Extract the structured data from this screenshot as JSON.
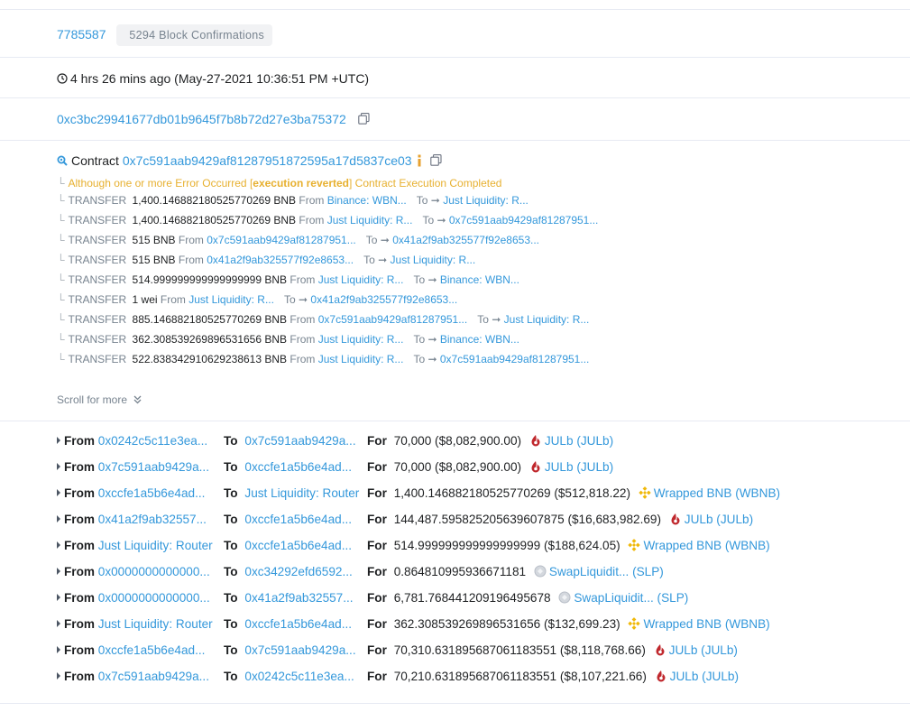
{
  "block": {
    "number": "7785587",
    "confirmations": "5294 Block Confirmations"
  },
  "timestamp": "4 hrs 26 mins ago (May-27-2021 10:36:51 PM +UTC)",
  "from_address": "0xc3bc29941677db01b9645f7b8b72d27e3ba75372",
  "interacted_with": {
    "prefix": "Contract",
    "address": "0x7c591aab9429af81287951872595a17d5837ce03"
  },
  "internal_error": {
    "part1": "Although one or more Error Occurred [",
    "bold": "execution reverted",
    "part2": "] Contract Execution Completed"
  },
  "internal_transfers": [
    {
      "label": "TRANSFER",
      "amount": "1,400.146882180525770269 BNB",
      "from_label": "From",
      "from": "Binance: WBN...",
      "to_label": "To",
      "to": "Just Liquidity: R..."
    },
    {
      "label": "TRANSFER",
      "amount": "1,400.146882180525770269 BNB",
      "from_label": "From",
      "from": "Just Liquidity: R...",
      "to_label": "To",
      "to": "0x7c591aab9429af81287951..."
    },
    {
      "label": "TRANSFER",
      "amount": "515 BNB",
      "from_label": "From",
      "from": "0x7c591aab9429af81287951...",
      "to_label": "To",
      "to": "0x41a2f9ab325577f92e8653..."
    },
    {
      "label": "TRANSFER",
      "amount": "515 BNB",
      "from_label": "From",
      "from": "0x41a2f9ab325577f92e8653...",
      "to_label": "To",
      "to": "Just Liquidity: R..."
    },
    {
      "label": "TRANSFER",
      "amount": "514.999999999999999999 BNB",
      "from_label": "From",
      "from": "Just Liquidity: R...",
      "to_label": "To",
      "to": "Binance: WBN..."
    },
    {
      "label": "TRANSFER",
      "amount": "1 wei",
      "from_label": "From",
      "from": "Just Liquidity: R...",
      "to_label": "To",
      "to": "0x41a2f9ab325577f92e8653..."
    },
    {
      "label": "TRANSFER",
      "amount": "885.146882180525770269 BNB",
      "from_label": "From",
      "from": "0x7c591aab9429af81287951...",
      "to_label": "To",
      "to": "Just Liquidity: R..."
    },
    {
      "label": "TRANSFER",
      "amount": "362.308539269896531656 BNB",
      "from_label": "From",
      "from": "Just Liquidity: R...",
      "to_label": "To",
      "to": "Binance: WBN..."
    },
    {
      "label": "TRANSFER",
      "amount": "522.838342910629238613 BNB",
      "from_label": "From",
      "from": "Just Liquidity: R...",
      "to_label": "To",
      "to": "0x7c591aab9429af81287951..."
    }
  ],
  "scroll_more": "Scroll for more",
  "token_transfers": [
    {
      "from_label": "From",
      "from": "0x0242c5c11e3ea...",
      "to_label": "To",
      "to": "0x7c591aab9429a...",
      "for_label": "For",
      "amount": "70,000 ($8,082,900.00)",
      "token": "JULb (JULb)",
      "icon": "julb-icon"
    },
    {
      "from_label": "From",
      "from": "0x7c591aab9429a...",
      "to_label": "To",
      "to": "0xccfe1a5b6e4ad...",
      "for_label": "For",
      "amount": "70,000 ($8,082,900.00)",
      "token": "JULb (JULb)",
      "icon": "julb-icon"
    },
    {
      "from_label": "From",
      "from": "0xccfe1a5b6e4ad...",
      "to_label": "To",
      "to": "Just Liquidity: Router",
      "for_label": "For",
      "amount": "1,400.146882180525770269 ($512,818.22)",
      "token": "Wrapped BNB (WBNB)",
      "icon": "bnb-icon"
    },
    {
      "from_label": "From",
      "from": "0x41a2f9ab32557...",
      "to_label": "To",
      "to": "0xccfe1a5b6e4ad...",
      "for_label": "For",
      "amount": "144,487.595825205639607875 ($16,683,982.69)",
      "token": "JULb (JULb)",
      "icon": "julb-icon"
    },
    {
      "from_label": "From",
      "from": "Just Liquidity: Router",
      "to_label": "To",
      "to": "0xccfe1a5b6e4ad...",
      "for_label": "For",
      "amount": "514.999999999999999999 ($188,624.05)",
      "token": "Wrapped BNB (WBNB)",
      "icon": "bnb-icon"
    },
    {
      "from_label": "From",
      "from": "0x0000000000000...",
      "to_label": "To",
      "to": "0xc34292efd6592...",
      "for_label": "For",
      "amount": "0.864810995936671181",
      "token": "SwapLiquidit... (SLP)",
      "icon": "slp-icon"
    },
    {
      "from_label": "From",
      "from": "0x0000000000000...",
      "to_label": "To",
      "to": "0x41a2f9ab32557...",
      "for_label": "For",
      "amount": "6,781.768441209196495678",
      "token": "SwapLiquidit... (SLP)",
      "icon": "slp-icon"
    },
    {
      "from_label": "From",
      "from": "Just Liquidity: Router",
      "to_label": "To",
      "to": "0xccfe1a5b6e4ad...",
      "for_label": "For",
      "amount": "362.308539269896531656 ($132,699.23)",
      "token": "Wrapped BNB (WBNB)",
      "icon": "bnb-icon"
    },
    {
      "from_label": "From",
      "from": "0xccfe1a5b6e4ad...",
      "to_label": "To",
      "to": "0x7c591aab9429a...",
      "for_label": "For",
      "amount": "70,310.631895687061183551 ($8,118,768.66)",
      "token": "JULb (JULb)",
      "icon": "julb-icon"
    },
    {
      "from_label": "From",
      "from": "0x7c591aab9429a...",
      "to_label": "To",
      "to": "0x0242c5c11e3ea...",
      "for_label": "For",
      "amount": "70,210.631895687061183551 ($8,107,221.66)",
      "token": "JULb (JULb)",
      "icon": "julb-icon"
    }
  ]
}
